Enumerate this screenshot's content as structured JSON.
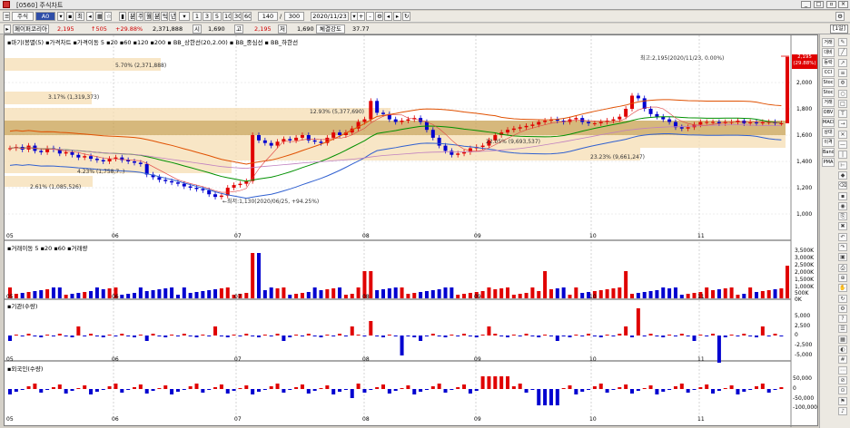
{
  "window": {
    "title": "[0560] 주식차트"
  },
  "toolbar1": {
    "market": "주식",
    "code": "A0",
    "period_buttons": [
      "분",
      "주",
      "월",
      "분",
      "틱",
      "년"
    ],
    "minute_buttons": [
      "1",
      "3",
      "5",
      "10",
      "30",
      "60"
    ],
    "count": "140",
    "total": "300",
    "date": "2020/11/23"
  },
  "toolbar2": {
    "name": "페이퍼코리아",
    "price": "2,195",
    "change": "↑505",
    "pct": "+29.88%",
    "volume": "2,371,888",
    "open_label": "시",
    "open": "1,690",
    "high_label": "고",
    "high": "2,195",
    "low_label": "저",
    "low": "1,690",
    "strength_label": "체결강도",
    "strength": "37.77"
  },
  "period": "[1일]",
  "price_pane": {
    "legend": "▪마기(봉멸(5)  ▪가격차트  ▪가격이동 5  ▪20  ▪60  ▪120  ▪200  ▪ BB_상한선(20,2.00)  ▪ BB_중심선  ▪ BB_하한선",
    "yticks": [
      "2,000",
      "1,800",
      "1,600",
      "1,400",
      "1,200",
      "1,000"
    ],
    "last_price_box": "2,195\n(29.88%)",
    "annotations": {
      "max": "최고:2,195(2020/11/23, 0.00%)",
      "min": "←최저:1,130(2020/06/25, +94.25%)",
      "p570": "5.70% (2,371,888)",
      "p317": "3.17% (1,319,373)",
      "p1293": "12.93% (5,377,690)",
      "p423": "4.23% (1,758,7..)",
      "p261": "2.61% (1,085,526)",
      "p2323": "23.23% (9,661,247)",
      "p2205": "22.05% (9,693,537)"
    }
  },
  "volume_pane": {
    "legend": "▪거래이동 5  ▪20  ▪60  ▪거래량",
    "yticks": [
      "3,500K",
      "3,000K",
      "2,500K",
      "2,000K",
      "1,500K",
      "1,000K",
      "500K",
      "0K"
    ]
  },
  "inst_pane": {
    "legend": "▪기관(수량)",
    "yticks": [
      "5,000",
      "2,500",
      "0",
      "-2,500",
      "-5,000"
    ]
  },
  "foreign_pane": {
    "legend": "▪외국인(수량)",
    "yticks": [
      "50,000",
      "0",
      "-50,000",
      "-100,000"
    ]
  },
  "xaxis": [
    "05",
    "06",
    "07",
    "08",
    "09",
    "10",
    "11"
  ],
  "rightbar": [
    "거래",
    "대비",
    "등락",
    "CCI",
    "Stoc",
    "Stoc",
    "거래량",
    "OBV",
    "MACD",
    "상대",
    "이격",
    "Band",
    "PMA"
  ],
  "colors": {
    "up": "#e00000",
    "down": "#0000d0",
    "ma20": "#009000",
    "bbUpper": "#e05000",
    "bbLower": "#3060d0",
    "box": "#f5deb3",
    "boxDark": "#c8a050"
  }
}
